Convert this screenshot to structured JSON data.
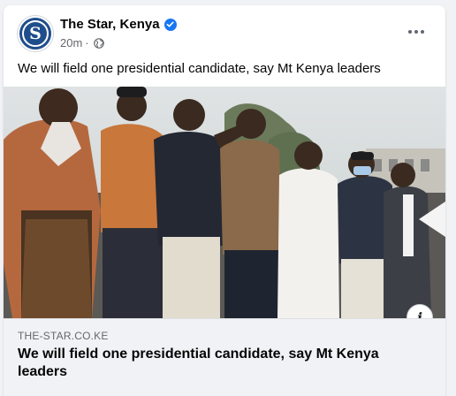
{
  "post": {
    "page_name": "The Star, Kenya",
    "avatar_letter": "S",
    "timestamp": "20m",
    "separator": "·",
    "text": "We will field one presidential candidate, say Mt Kenya leaders"
  },
  "link_preview": {
    "domain": "THE-STAR.CO.KE",
    "title": "We will field one presidential candidate, say Mt Kenya leaders",
    "info_glyph": "i"
  },
  "icons": {
    "verified": "verified-badge-icon",
    "audience": "globe-icon",
    "more": "more-options-icon",
    "info": "info-icon"
  },
  "colors": {
    "brand_blue": "#1f4e8c",
    "verified_blue": "#1877f2",
    "secondary_text": "#65676b"
  }
}
